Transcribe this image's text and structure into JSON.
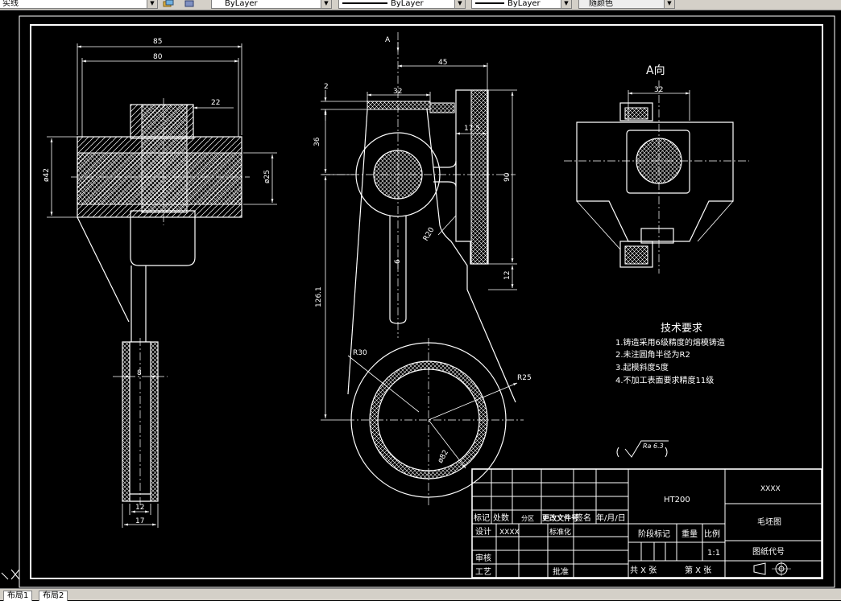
{
  "toolbar": {
    "layer_combo": "实线",
    "color_combo": "ByLayer",
    "linetype_combo": "ByLayer",
    "lineweight_combo": "ByLayer",
    "plotstyle_combo": "随颜色"
  },
  "tabs": [
    "布局1",
    "布局2"
  ],
  "colors": {
    "line": "#ffffff",
    "background": "#000000",
    "hatch": "#ffffff"
  },
  "drawing": {
    "left_view": {
      "dims": {
        "d85": "85",
        "d80": "80",
        "d22": "22",
        "d42": "ø42",
        "d25": "ø25",
        "d8": "8",
        "d12": "12",
        "d17": "17"
      }
    },
    "front_view": {
      "dims": {
        "a_label": "A",
        "d45": "45",
        "d2": "2",
        "d32": "32",
        "d36": "36",
        "d17_5": "17.5",
        "d90": "90",
        "d6": "6",
        "d12": "12",
        "d126": "126.1",
        "r20": "R20",
        "r30": "R30",
        "r25": "R25",
        "d82": "ø82"
      }
    },
    "view_a": {
      "title": "A向",
      "dims": {
        "d32": "32"
      }
    },
    "tech_req": {
      "title": "技术要求",
      "items": [
        "1.铸造采用6级精度的熔模铸造",
        "2.未注圆角半径为R2",
        "3.起模斜度5度",
        "4.不加工表面要求精度11级"
      ]
    },
    "roughness": "Ra 6.3",
    "title_block": {
      "material": "HT200",
      "part_name": "XXXX",
      "drawing_name": "毛坯图",
      "drawing_code": "图纸代号",
      "scale_label": "比例",
      "scale": "1:1",
      "weight": "重量",
      "stage_mark": "阶段标记",
      "sheets": "共 X 张",
      "sheet_no": "第 X 张",
      "h_mark": "标记",
      "h_count": "处数",
      "h_zone": "分区",
      "h_docno": "更改文件号",
      "h_sign": "签名",
      "h_date": "年/月/日",
      "designer_label": "设计",
      "designer": "XXXX",
      "standard": "标准化",
      "checker": "审核",
      "process": "工艺",
      "approve": "批准"
    }
  }
}
